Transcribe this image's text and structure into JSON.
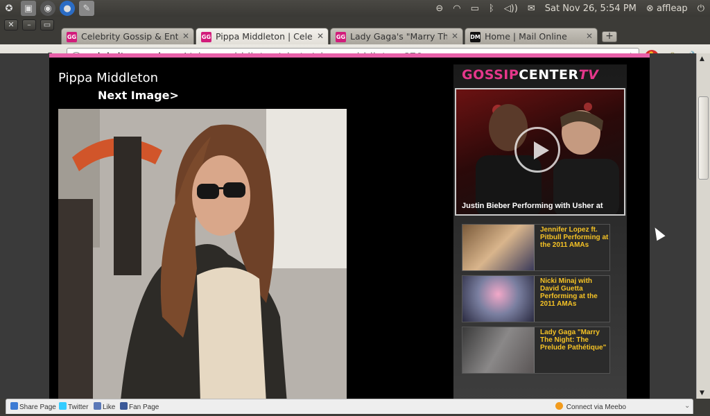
{
  "top_panel": {
    "user": "affleap",
    "datetime": "Sat Nov 26,  5:54 PM",
    "icons": [
      "ubuntu-logo-icon",
      "cube-icon",
      "steam-icon",
      "chromium-icon",
      "text-editor-icon",
      "shutdown-icon"
    ]
  },
  "browser": {
    "tabs": [
      {
        "label": "Celebrity Gossip & Enter",
        "favicon": "GG",
        "active": false
      },
      {
        "label": "Pippa Middleton | Celebr",
        "favicon": "GG",
        "active": true
      },
      {
        "label": "Lady Gaga's \"Marry The",
        "favicon": "GG",
        "active": false
      },
      {
        "label": "Home | Mail Online",
        "favicon": "DM",
        "active": false
      }
    ],
    "url_host": "celebrity-gossip.net",
    "url_path": "/pippa-middleton/photo/pippa-middleton-670"
  },
  "page": {
    "title": "Pippa Middleton",
    "next_link": "Next Image>",
    "sidebar": {
      "logo_part1": "GOSSIP",
      "logo_part2": "CENTER",
      "logo_part3": "TV",
      "featured_caption": "Justin Bieber Performing with Usher at",
      "videos": [
        {
          "caption": "Jennifer Lopez ft. Pitbull Performing at the 2011 AMAs"
        },
        {
          "caption": "Nicki Minaj with David Guetta Performing at the 2011 AMAs"
        },
        {
          "caption": "Lady Gaga \"Marry The Night: The Prelude Pathétique\""
        }
      ]
    }
  },
  "share_bar": {
    "share": "Share Page",
    "twitter": "Twitter",
    "like": "Like",
    "fan": "Fan Page",
    "meebo": "Connect via Meebo"
  },
  "colors": {
    "accent_pink": "#e75fa8",
    "caption_yellow": "#f6c325"
  }
}
